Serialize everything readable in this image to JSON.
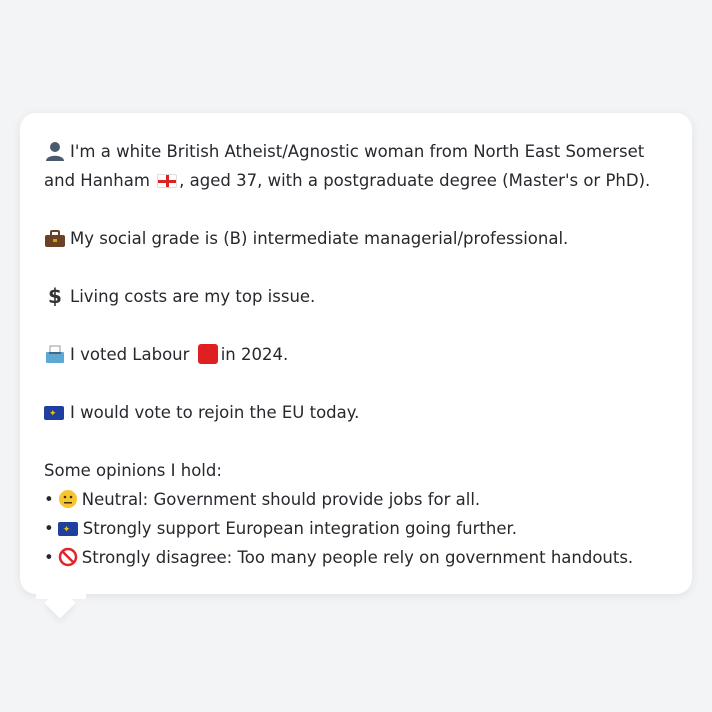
{
  "profile": {
    "identity_emoji": "👤",
    "identity_text_1": "I'm a white British Atheist/Agnostic woman from North East Somerset and Hanham",
    "identity_text_2": ", aged 37, with a postgraduate degree (Master's or PhD).",
    "social_emoji": "💼",
    "social_text": "My social grade is (B) intermediate managerial/professional.",
    "issue_emoji": "💲",
    "issue_text": "Living costs are my top issue.",
    "vote_emoji": "🗳",
    "vote_text_1": "I voted Labour",
    "vote_text_2": "in 2024.",
    "eu_text": "I would vote to rejoin the EU today."
  },
  "opinions": {
    "title": "Some opinions I hold:",
    "bullet": "•",
    "items": [
      {
        "emoji": "😐",
        "text": "Neutral: Government should provide jobs for all."
      },
      {
        "emoji": "🇪🇺",
        "text": "Strongly support European integration going further."
      },
      {
        "emoji": "🚫",
        "text": "Strongly disagree: Too many people rely on government handouts."
      }
    ]
  },
  "colors": {
    "background": "#f3f4f6",
    "bubble": "#ffffff",
    "text": "#25282d",
    "labour_red": "#e02020",
    "eu_blue": "#1f3fa0"
  }
}
